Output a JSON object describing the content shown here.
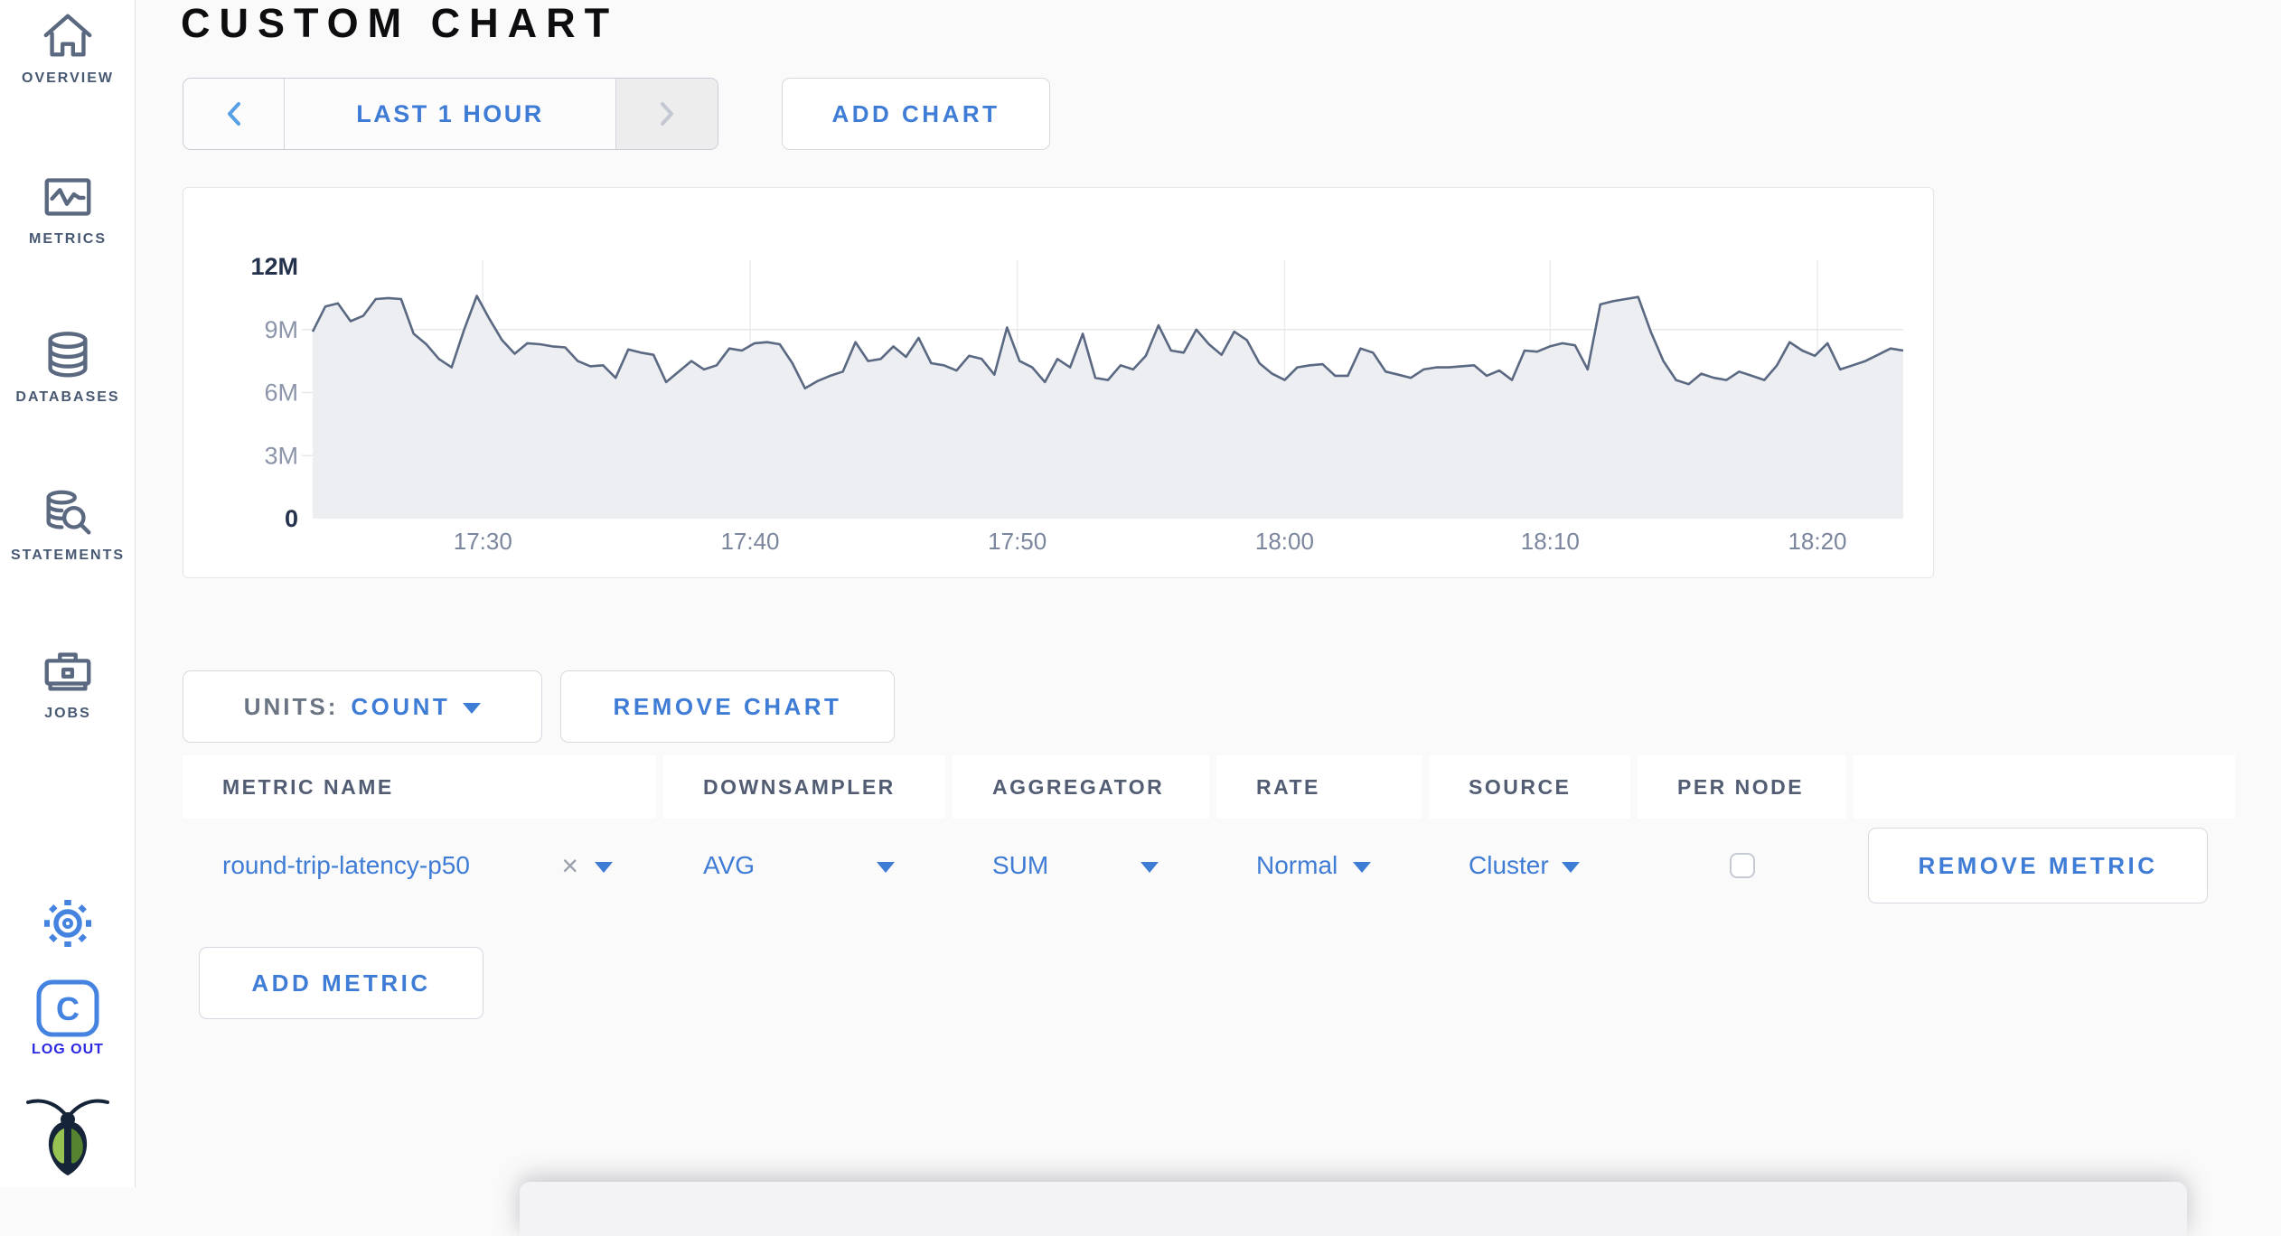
{
  "sidebar": {
    "items": [
      {
        "label": "OVERVIEW"
      },
      {
        "label": "METRICS"
      },
      {
        "label": "DATABASES"
      },
      {
        "label": "STATEMENTS"
      },
      {
        "label": "JOBS"
      }
    ],
    "logout_label": "LOG OUT"
  },
  "header": {
    "title": "CUSTOM CHART"
  },
  "toolbar": {
    "time_range_label": "LAST 1 HOUR",
    "add_chart_label": "ADD CHART"
  },
  "chart_controls": {
    "units_label": "UNITS:",
    "units_value": "COUNT",
    "remove_chart_label": "REMOVE CHART",
    "add_metric_label": "ADD METRIC"
  },
  "metrics_table": {
    "columns": [
      "METRIC NAME",
      "DOWNSAMPLER",
      "AGGREGATOR",
      "RATE",
      "SOURCE",
      "PER NODE",
      ""
    ],
    "rows": [
      {
        "metric_name": "round-trip-latency-p50",
        "downsampler": "AVG",
        "aggregator": "SUM",
        "rate": "Normal",
        "source": "Cluster",
        "per_node_checked": false,
        "remove_label": "REMOVE METRIC"
      }
    ]
  },
  "chart_data": {
    "type": "area",
    "title": "",
    "xlabel": "",
    "ylabel": "",
    "unit": "count",
    "ylim_millions": [
      0,
      12
    ],
    "grid": true,
    "y_ticks": [
      {
        "value_millions": 0,
        "label": "0",
        "strong": true
      },
      {
        "value_millions": 3,
        "label": "3M",
        "strong": false
      },
      {
        "value_millions": 6,
        "label": "6M",
        "strong": false
      },
      {
        "value_millions": 9,
        "label": "9M",
        "strong": false
      },
      {
        "value_millions": 12,
        "label": "12M",
        "strong": true
      }
    ],
    "x_ticks": [
      {
        "label": "17:30",
        "fraction": 0.107
      },
      {
        "label": "17:40",
        "fraction": 0.275
      },
      {
        "label": "17:50",
        "fraction": 0.443
      },
      {
        "label": "18:00",
        "fraction": 0.611
      },
      {
        "label": "18:10",
        "fraction": 0.778
      },
      {
        "label": "18:20",
        "fraction": 0.946
      }
    ],
    "series": [
      {
        "name": "round-trip-latency-p50",
        "values_millions": [
          8.9,
          10.1,
          10.25,
          9.4,
          9.65,
          10.45,
          10.5,
          10.45,
          8.8,
          8.3,
          7.6,
          7.2,
          9.0,
          10.6,
          9.5,
          8.5,
          7.85,
          8.35,
          8.3,
          8.2,
          8.15,
          7.5,
          7.25,
          7.3,
          6.7,
          8.05,
          7.9,
          7.8,
          6.5,
          7.0,
          7.5,
          7.1,
          7.3,
          8.1,
          8.0,
          8.35,
          8.4,
          8.3,
          7.4,
          6.2,
          6.55,
          6.8,
          7.0,
          8.4,
          7.5,
          7.6,
          8.2,
          7.7,
          8.6,
          7.4,
          7.3,
          7.05,
          7.75,
          7.6,
          6.85,
          9.1,
          7.5,
          7.2,
          6.5,
          7.6,
          7.2,
          8.8,
          6.7,
          6.6,
          7.3,
          7.1,
          7.75,
          9.2,
          8.0,
          7.9,
          9.0,
          8.3,
          7.8,
          8.9,
          8.5,
          7.4,
          6.9,
          6.6,
          7.2,
          7.3,
          7.35,
          6.8,
          6.8,
          8.1,
          7.9,
          7.0,
          6.85,
          6.7,
          7.1,
          7.2,
          7.2,
          7.25,
          7.3,
          6.8,
          7.05,
          6.6,
          8.0,
          7.95,
          8.2,
          8.35,
          8.25,
          7.1,
          10.2,
          10.35,
          10.45,
          10.55,
          8.9,
          7.5,
          6.6,
          6.4,
          6.9,
          6.7,
          6.6,
          7.0,
          6.8,
          6.6,
          7.3,
          8.4,
          8.0,
          7.75,
          8.35,
          7.1,
          7.3,
          7.5,
          7.8,
          8.1,
          8.0
        ]
      }
    ]
  },
  "colors": {
    "accent_blue": "#3e7cd6",
    "sidebar_slate": "#475872",
    "logout_blue": "#2b28e0",
    "chart_line": "#5a6882",
    "chart_fill": "#edeef2",
    "grid_line": "#ebecef"
  }
}
